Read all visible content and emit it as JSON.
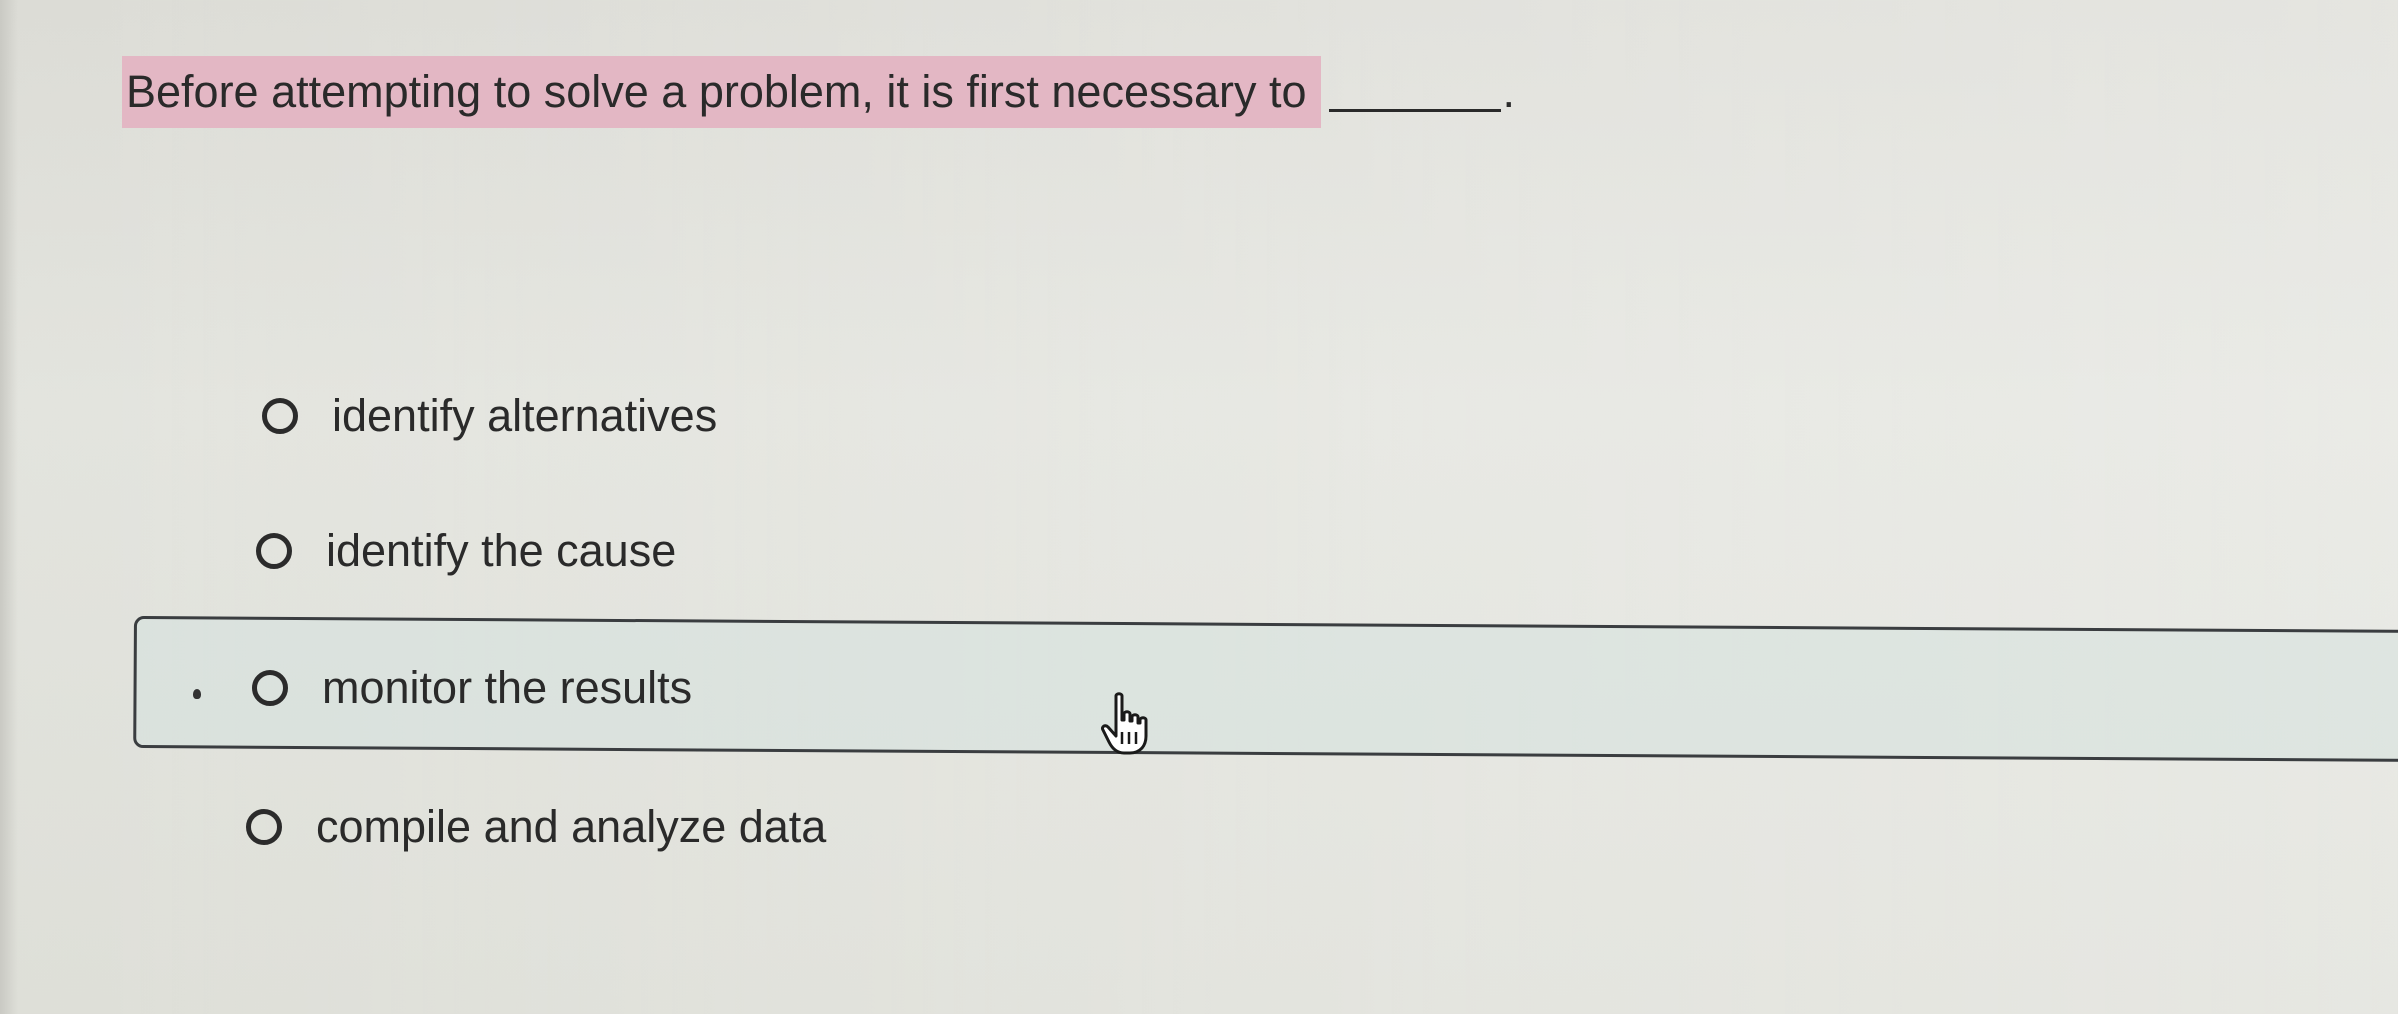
{
  "question": {
    "text": "Before attempting to solve a problem, it is first necessary to",
    "period": "."
  },
  "options": [
    {
      "label": "identify alternatives",
      "selected": false
    },
    {
      "label": "identify the cause",
      "selected": false
    },
    {
      "label": "monitor the results",
      "selected": false,
      "hovered": true
    },
    {
      "label": "compile and analyze data",
      "selected": false
    }
  ],
  "colors": {
    "highlight": "#e3b7c4",
    "hover_row": "#d6e2de",
    "text": "#2a2a2a"
  },
  "icons": {
    "pointer": "hand-pointer-icon",
    "radio": "radio-empty-icon"
  }
}
